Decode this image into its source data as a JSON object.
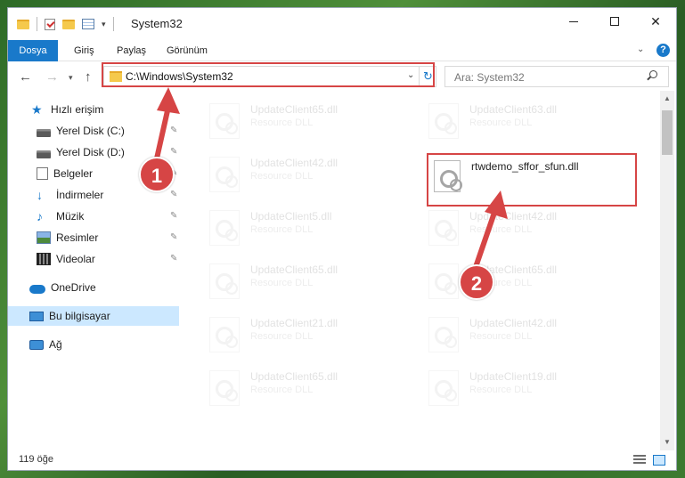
{
  "window": {
    "title": "System32"
  },
  "ribbon": {
    "tabs": [
      "Dosya",
      "Giriş",
      "Paylaş",
      "Görünüm"
    ]
  },
  "navbar": {
    "address": "C:\\Windows\\System32",
    "search_placeholder": "Ara: System32"
  },
  "sidebar": {
    "items": [
      {
        "label": "Hızlı erişim",
        "icon": "star-icon",
        "pinned": false
      },
      {
        "label": "Yerel Disk (C:)",
        "icon": "drive-icon",
        "pinned": true
      },
      {
        "label": "Yerel Disk (D:)",
        "icon": "drive-icon",
        "pinned": true
      },
      {
        "label": "Belgeler",
        "icon": "documents-icon",
        "pinned": true
      },
      {
        "label": "İndirmeler",
        "icon": "downloads-icon",
        "pinned": true
      },
      {
        "label": "Müzik",
        "icon": "music-icon",
        "pinned": true
      },
      {
        "label": "Resimler",
        "icon": "pictures-icon",
        "pinned": true
      },
      {
        "label": "Videolar",
        "icon": "videos-icon",
        "pinned": true
      },
      {
        "label": "OneDrive",
        "icon": "cloud-icon",
        "pinned": false
      },
      {
        "label": "Bu bilgisayar",
        "icon": "computer-icon",
        "pinned": false,
        "selected": true
      },
      {
        "label": "Ağ",
        "icon": "network-icon",
        "pinned": false
      }
    ]
  },
  "files": [
    {
      "name": "UpdateClient65.dll",
      "type": "Resource DLL",
      "faded": true
    },
    {
      "name": "UpdateClient63.dll",
      "type": "Resource DLL",
      "faded": true
    },
    {
      "name": "UpdateClient42.dll",
      "type": "Resource DLL",
      "faded": true
    },
    {
      "name": "rtwdemo_sffor_sfun.dll",
      "type": "",
      "faded": false,
      "highlight": true
    },
    {
      "name": "UpdateClient5.dll",
      "type": "Resource DLL",
      "faded": true
    },
    {
      "name": "UpdateClient42.dll",
      "type": "Resource DLL",
      "faded": true
    },
    {
      "name": "UpdateClient65.dll",
      "type": "Resource DLL",
      "faded": true
    },
    {
      "name": "UpdateClient65.dll",
      "type": "Resource DLL",
      "faded": true
    },
    {
      "name": "UpdateClient21.dll",
      "type": "Resource DLL",
      "faded": true
    },
    {
      "name": "UpdateClient42.dll",
      "type": "Resource DLL",
      "faded": true
    },
    {
      "name": "UpdateClient65.dll",
      "type": "Resource DLL",
      "faded": true
    },
    {
      "name": "UpdateClient19.dll",
      "type": "Resource DLL",
      "faded": true
    }
  ],
  "status": {
    "item_count": "119 öğe"
  },
  "annotations": {
    "step1": "1",
    "step2": "2",
    "color": "#d64545"
  }
}
